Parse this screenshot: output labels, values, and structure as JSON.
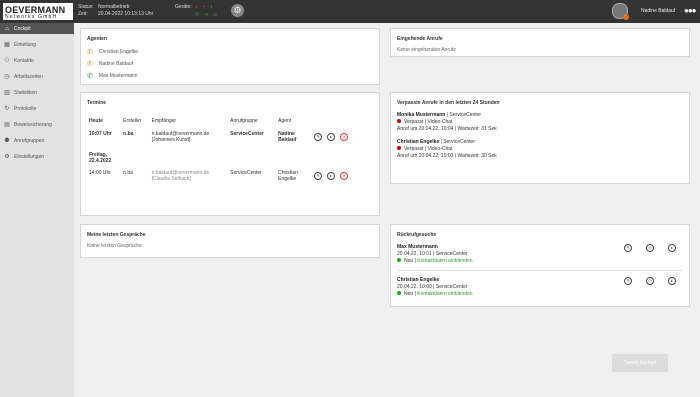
{
  "app": {
    "logo_line1": "OEVERMANN",
    "logo_line2": "Networks GmbH"
  },
  "topbar": {
    "status_label": "Status:",
    "status_value": "Normalbetrieb",
    "time_label": "Zeit:",
    "time_value": "20.04.2022 10:13:13 Uhr",
    "devices_label": "Geräte:",
    "user_name": "Nadine Baldauf"
  },
  "sidebar": {
    "items": [
      {
        "label": "Cockpit",
        "icon": "home-icon",
        "glyph": "⌂"
      },
      {
        "label": "Einteilung",
        "icon": "grid-icon",
        "glyph": "▦"
      },
      {
        "label": "Kontakte",
        "icon": "contacts-icon",
        "glyph": "⚇"
      },
      {
        "label": "Arbeitszeiten",
        "icon": "clock-icon",
        "glyph": "◷"
      },
      {
        "label": "Statistiken",
        "icon": "chart-icon",
        "glyph": "▥"
      },
      {
        "label": "Protokolle",
        "icon": "log-icon",
        "glyph": "↻"
      },
      {
        "label": "Beweissicherung",
        "icon": "archive-icon",
        "glyph": "▤"
      },
      {
        "label": "Anrufgruppen",
        "icon": "group-icon",
        "glyph": "⚉"
      },
      {
        "label": "Einstellungen",
        "icon": "gear-icon",
        "glyph": "⚙"
      }
    ]
  },
  "agents": {
    "title": "Agenten",
    "list": [
      {
        "name": "Christian Engelke",
        "status": "busy"
      },
      {
        "name": "Nadine Baldauf",
        "status": "busy"
      },
      {
        "name": "Max Mustermann",
        "status": "available"
      }
    ]
  },
  "incoming": {
    "title": "Eingehende Anrufe",
    "empty": "Keine eingehenden Anrufe"
  },
  "appointments": {
    "title": "Termine",
    "headers": [
      "Heute",
      "Ersteller",
      "Empfänger",
      "Anrufgruppe",
      "Agent"
    ],
    "row1": {
      "time": "10:07 Uhr",
      "creator": "n.ba",
      "recipient_email": "n.baldauf@oevermann.de",
      "recipient_name": "[Johannes Kunst]",
      "group": "ServiceCenter",
      "agent": "Nadine Baldauf"
    },
    "day2": "Freitag, 22.4.2022",
    "row2": {
      "time": "14:00 Uhr",
      "creator": "n.ba",
      "recipient_email": "n.baldauf@oevermann.de",
      "recipient_name": "[Claudia Selbach]",
      "group": "ServiceCenter",
      "agent": "Christian Engelke"
    }
  },
  "missed": {
    "title": "Verpasste Anrufe in den letzten 24 Stunden",
    "calls": [
      {
        "name": "Monika Mustermann",
        "group": "ServiceCenter",
        "status": "Verpasst",
        "channel": "Video-Chat",
        "detail": "Anruf um 20.04.22, 10:04 | Wartezeit: 31 Sek"
      },
      {
        "name": "Christian Engelke",
        "group": "ServiceCenter",
        "status": "Verpasst",
        "channel": "Video-Chat",
        "detail": "Anruf um 20.04.22, 10:03 | Wartezeit: 30 Sek"
      }
    ]
  },
  "recent": {
    "title": "Meine letzten Gespräche",
    "empty": "Keine letzten Gespräche"
  },
  "callbacks": {
    "title": "Rückrufgesuche",
    "items": [
      {
        "name": "Max Mustermann",
        "detail": "20.04.22, 10:01 | ServiceCenter",
        "status": "Neu",
        "link": "Kontaktdaten einblenden"
      },
      {
        "name": "Christian Engelke",
        "detail": "20.04.22, 10:00 | ServiceCenter",
        "status": "Neu",
        "link": "Kontaktdaten einblenden"
      }
    ]
  },
  "footer": {
    "save_label": "Termin buchen"
  },
  "colors": {
    "accent_green": "#3a9a3a",
    "alert_red": "#cc0000",
    "topbar": "#333333"
  }
}
